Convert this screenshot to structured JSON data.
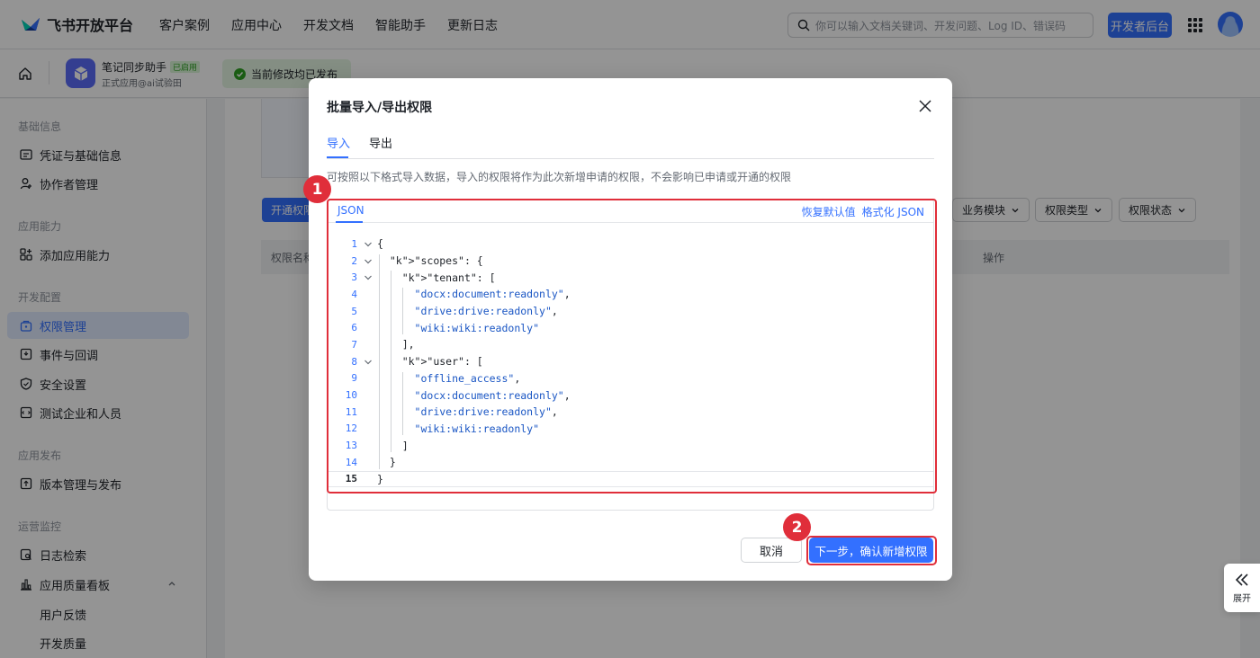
{
  "brand": {
    "name": "飞书开放平台"
  },
  "nav": [
    "客户案例",
    "应用中心",
    "开发文档",
    "智能助手",
    "更新日志"
  ],
  "search": {
    "placeholder": "你可以输入文档关键词、开发问题、Log ID、错误码"
  },
  "header": {
    "dev_console_label": "开发者后台"
  },
  "app": {
    "name": "笔记同步助手",
    "status_badge": "已启用",
    "subtitle": "正式应用@ai试验田",
    "publish_status": "当前修改均已发布"
  },
  "sidebar": {
    "sections": [
      {
        "title": "基础信息",
        "items": [
          {
            "label": "凭证与基础信息",
            "icon": "id-card-icon"
          },
          {
            "label": "协作者管理",
            "icon": "user-add-icon"
          }
        ]
      },
      {
        "title": "应用能力",
        "items": [
          {
            "label": "添加应用能力",
            "icon": "apps-add-icon"
          }
        ]
      },
      {
        "title": "开发配置",
        "items": [
          {
            "label": "权限管理",
            "icon": "lock-icon",
            "active": true
          },
          {
            "label": "事件与回调",
            "icon": "event-icon"
          },
          {
            "label": "安全设置",
            "icon": "shield-icon"
          },
          {
            "label": "测试企业和人员",
            "icon": "test-icon"
          }
        ]
      },
      {
        "title": "应用发布",
        "items": [
          {
            "label": "版本管理与发布",
            "icon": "upload-icon"
          }
        ]
      },
      {
        "title": "运营监控",
        "items": [
          {
            "label": "日志检索",
            "icon": "log-search-icon"
          },
          {
            "label": "应用质量看板",
            "icon": "bar-chart-icon"
          },
          {
            "label": "用户反馈"
          },
          {
            "label": "开发质量"
          }
        ]
      }
    ]
  },
  "main": {
    "open_permission_label": "开通权限",
    "filters": [
      "业务模块",
      "权限类型",
      "权限状态"
    ],
    "table_headers": [
      "权限名称",
      "操作"
    ]
  },
  "expand_label": "展开",
  "modal": {
    "title": "批量导入/导出权限",
    "tabs": [
      "导入",
      "导出"
    ],
    "description": "可按照以下格式导入数据，导入的权限将作为此次新增申请的权限，不会影响已申请或开通的权限",
    "editor_tab": "JSON",
    "restore_label": "恢复默认值",
    "format_label": "格式化 JSON",
    "code_lines": [
      "{",
      "  \"scopes\": {",
      "    \"tenant\": [",
      "      \"docx:document:readonly\",",
      "      \"drive:drive:readonly\",",
      "      \"wiki:wiki:readonly\"",
      "    ],",
      "    \"user\": [",
      "      \"offline_access\",",
      "      \"docx:document:readonly\",",
      "      \"drive:drive:readonly\",",
      "      \"wiki:wiki:readonly\"",
      "    ]",
      "  }",
      "}"
    ],
    "line_numbers": [
      "1",
      "2",
      "3",
      "4",
      "5",
      "6",
      "7",
      "8",
      "9",
      "10",
      "11",
      "12",
      "13",
      "14",
      "15"
    ],
    "cancel_label": "取消",
    "next_label": "下一步，确认新增权限"
  },
  "annotations": {
    "badge1": "1",
    "badge2": "2"
  },
  "colors": {
    "accent": "#3370ff",
    "annotation": "#e02e3a",
    "success": "#2ea121"
  }
}
